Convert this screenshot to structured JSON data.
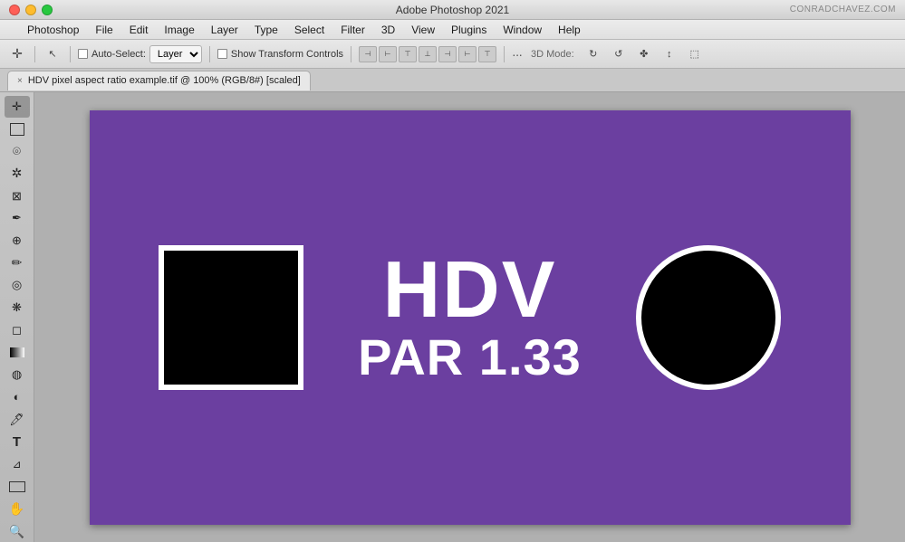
{
  "titleBar": {
    "appTitle": "Adobe Photoshop 2021",
    "website": "CONRADCHAVEZ.COM",
    "trafficButtons": [
      "close",
      "minimize",
      "maximize"
    ]
  },
  "menuBar": {
    "appleIcon": "",
    "items": [
      "Photoshop",
      "File",
      "Edit",
      "Image",
      "Layer",
      "Type",
      "Select",
      "Filter",
      "3D",
      "View",
      "Plugins",
      "Window",
      "Help"
    ]
  },
  "toolbar": {
    "autoSelectLabel": "Auto-Select:",
    "layerOption": "Layer",
    "showTransformControls": "Show Transform Controls",
    "dotsLabel": "···",
    "threeDLabel": "3D Mode:",
    "alignButtons": [
      "⊣",
      "⊢",
      "⊤",
      "⊥",
      "⊣",
      "⊢",
      "⊤",
      "⊥"
    ]
  },
  "tabBar": {
    "tab": {
      "closeIcon": "×",
      "label": "HDV pixel aspect ratio example.tif @ 100% (RGB/8#) [scaled]"
    }
  },
  "leftToolbar": {
    "tools": [
      {
        "name": "move-tool",
        "icon": "✛",
        "active": true
      },
      {
        "name": "selection-tool",
        "icon": "⬚"
      },
      {
        "name": "lasso-tool",
        "icon": "○"
      },
      {
        "name": "magic-wand-tool",
        "icon": "⚡"
      },
      {
        "name": "crop-tool",
        "icon": "⊠"
      },
      {
        "name": "eyedropper-tool",
        "icon": "✏"
      },
      {
        "name": "healing-tool",
        "icon": "🩹"
      },
      {
        "name": "brush-tool",
        "icon": "🖌"
      },
      {
        "name": "clone-tool",
        "icon": "◎"
      },
      {
        "name": "history-tool",
        "icon": "❋"
      },
      {
        "name": "eraser-tool",
        "icon": "◻"
      },
      {
        "name": "gradient-tool",
        "icon": "▦"
      },
      {
        "name": "blur-tool",
        "icon": "◍"
      },
      {
        "name": "dodge-tool",
        "icon": "◐"
      },
      {
        "name": "pen-tool",
        "icon": "✒"
      },
      {
        "name": "type-tool",
        "icon": "T"
      },
      {
        "name": "path-tool",
        "icon": "⊿"
      },
      {
        "name": "shape-tool",
        "icon": "▭"
      },
      {
        "name": "hand-tool",
        "icon": "✋"
      },
      {
        "name": "zoom-tool",
        "icon": "🔍"
      }
    ]
  },
  "canvas": {
    "backgroundColor": "#6b3fa0",
    "hdvTitle": "HDV",
    "hdvPar": "PAR 1.33",
    "squareBorderColor": "#ffffff",
    "circleBorderColor": "#ffffff"
  },
  "colors": {
    "canvasBg": "#6b3fa0",
    "white": "#ffffff",
    "black": "#000000"
  }
}
